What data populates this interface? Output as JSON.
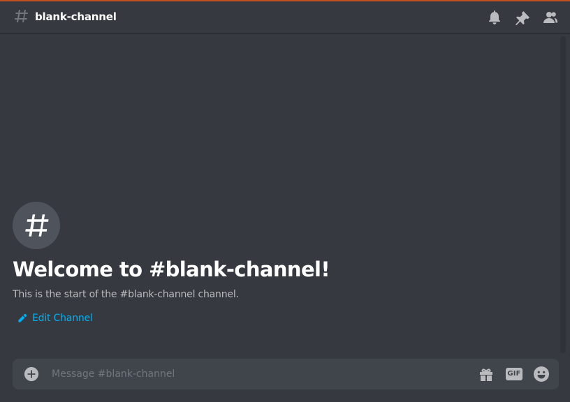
{
  "header": {
    "channel_name": "blank-channel",
    "icons": [
      "hash-icon",
      "bell-icon",
      "pin-icon",
      "members-icon"
    ]
  },
  "welcome": {
    "icon": "hash-icon",
    "title": "Welcome to #blank-channel!",
    "description": "This is the start of the #blank-channel channel.",
    "edit_label": "Edit Channel",
    "edit_icon": "pencil-icon"
  },
  "composer": {
    "placeholder": "Message #blank-channel",
    "value": "",
    "attach_icon": "plus-circle-icon",
    "gift_icon": "gift-icon",
    "gif_label": "GIF",
    "emoji_icon": "smiley-icon"
  },
  "colors": {
    "background": "#36393f",
    "header_text": "#ffffff",
    "muted_text": "#b9bbbe",
    "link": "#00b0f4",
    "icon": "#b9bbbe",
    "composer_bg": "#40444b",
    "accent_bar": "#c0501f"
  }
}
